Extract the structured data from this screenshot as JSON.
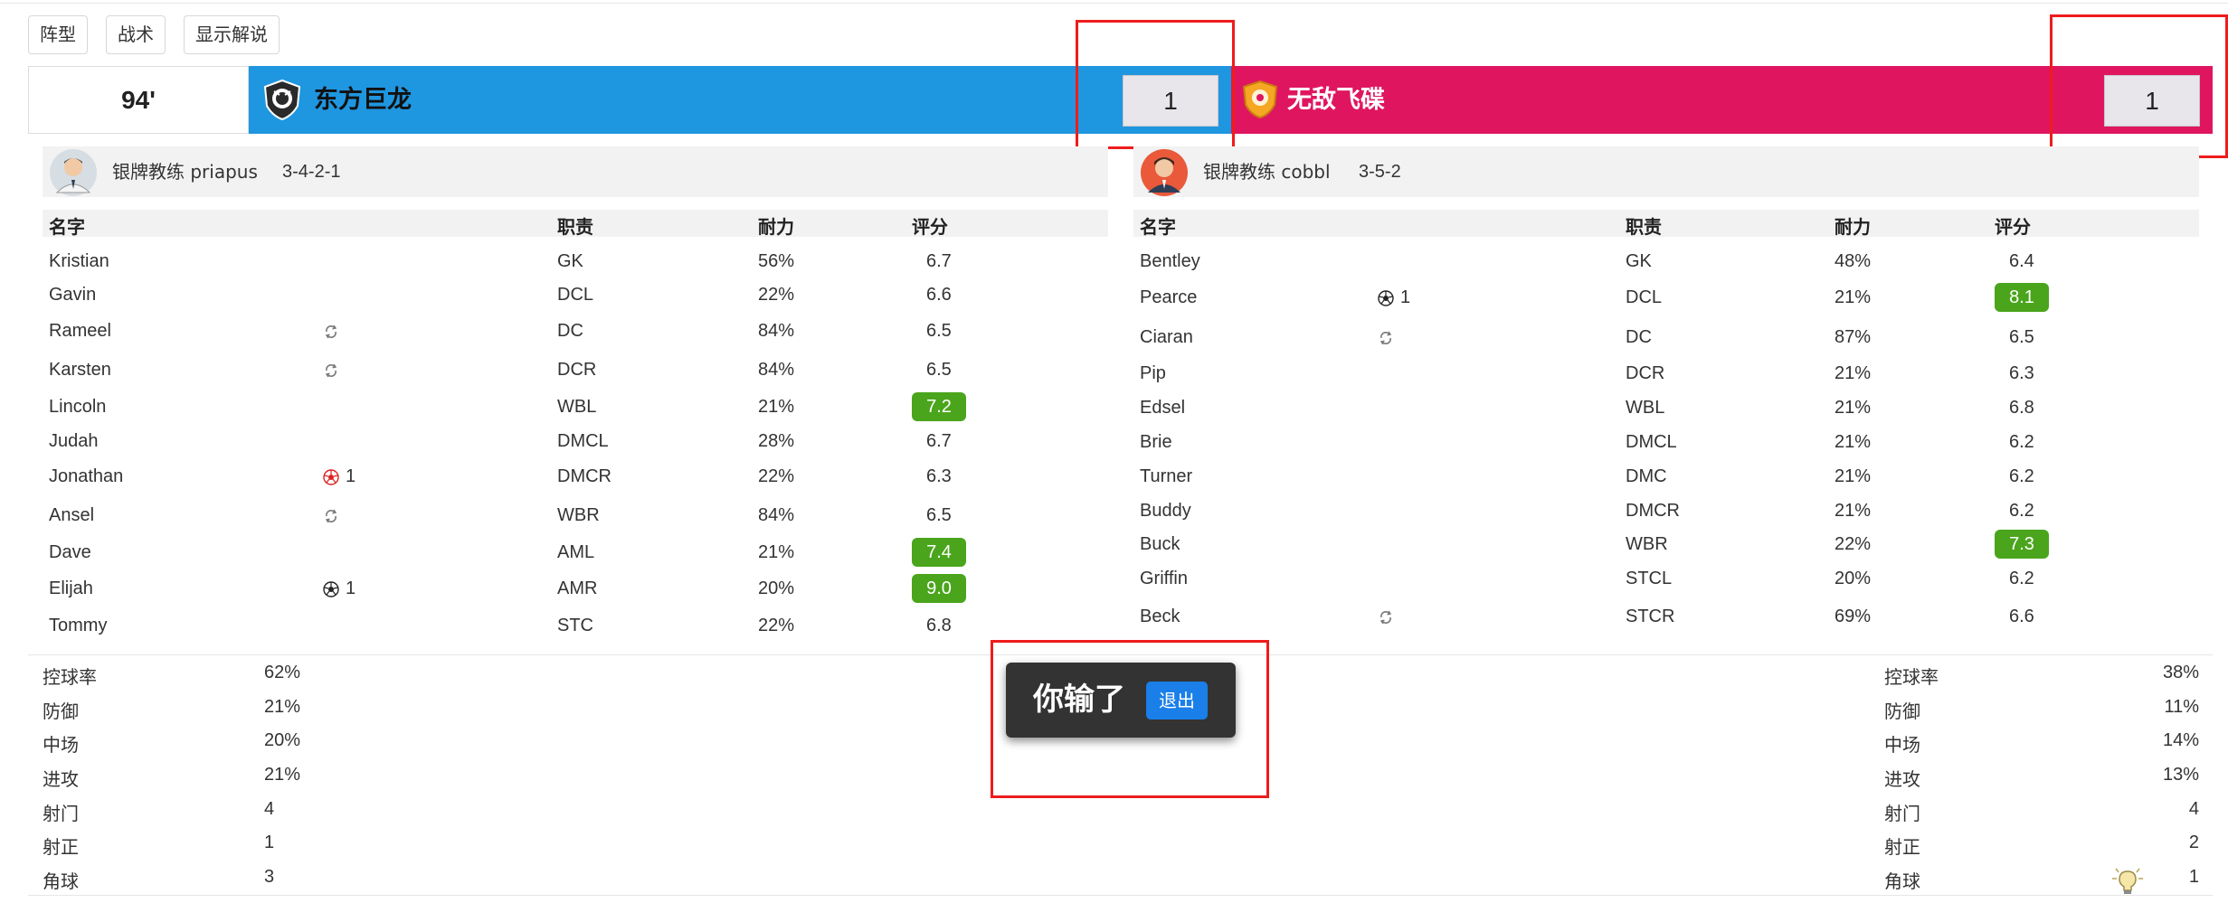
{
  "tabs": [
    "阵型",
    "战术",
    "显示解说"
  ],
  "match": {
    "minute": "94'",
    "home": {
      "name": "东方巨龙",
      "score": "1",
      "color": "#1f96e0"
    },
    "away": {
      "name": "无敌飞碟",
      "score": "1",
      "color": "#e0155f"
    }
  },
  "columns": {
    "name": "名字",
    "role": "职责",
    "stamina": "耐力",
    "rating": "评分"
  },
  "home_team": {
    "coach": "银牌教练 priapus",
    "formation": "3-4-2-1",
    "players": [
      {
        "name": "Kristian",
        "event": "",
        "event_count": "",
        "role": "GK",
        "stamina": "56%",
        "rating": "6.7",
        "highlight": false
      },
      {
        "name": "Gavin",
        "event": "",
        "event_count": "",
        "role": "DCL",
        "stamina": "22%",
        "rating": "6.6",
        "highlight": false
      },
      {
        "name": "Rameel",
        "event": "sub",
        "event_count": "",
        "role": "DC",
        "stamina": "84%",
        "rating": "6.5",
        "highlight": false
      },
      {
        "name": "Karsten",
        "event": "sub",
        "event_count": "",
        "role": "DCR",
        "stamina": "84%",
        "rating": "6.5",
        "highlight": false
      },
      {
        "name": "Lincoln",
        "event": "",
        "event_count": "",
        "role": "WBL",
        "stamina": "21%",
        "rating": "7.2",
        "highlight": true
      },
      {
        "name": "Judah",
        "event": "",
        "event_count": "",
        "role": "DMCL",
        "stamina": "28%",
        "rating": "6.7",
        "highlight": false
      },
      {
        "name": "Jonathan",
        "event": "red-ball",
        "event_count": "1",
        "role": "DMCR",
        "stamina": "22%",
        "rating": "6.3",
        "highlight": false
      },
      {
        "name": "Ansel",
        "event": "sub",
        "event_count": "",
        "role": "WBR",
        "stamina": "84%",
        "rating": "6.5",
        "highlight": false
      },
      {
        "name": "Dave",
        "event": "",
        "event_count": "",
        "role": "AML",
        "stamina": "21%",
        "rating": "7.4",
        "highlight": true
      },
      {
        "name": "Elijah",
        "event": "goal",
        "event_count": "1",
        "role": "AMR",
        "stamina": "20%",
        "rating": "9.0",
        "highlight": true
      },
      {
        "name": "Tommy",
        "event": "",
        "event_count": "",
        "role": "STC",
        "stamina": "22%",
        "rating": "6.8",
        "highlight": false
      }
    ]
  },
  "away_team": {
    "coach": "银牌教练 cobbl",
    "formation": "3-5-2",
    "players": [
      {
        "name": "Bentley",
        "event": "",
        "event_count": "",
        "role": "GK",
        "stamina": "48%",
        "rating": "6.4",
        "highlight": false
      },
      {
        "name": "Pearce",
        "event": "goal",
        "event_count": "1",
        "role": "DCL",
        "stamina": "21%",
        "rating": "8.1",
        "highlight": true
      },
      {
        "name": "Ciaran",
        "event": "sub",
        "event_count": "",
        "role": "DC",
        "stamina": "87%",
        "rating": "6.5",
        "highlight": false
      },
      {
        "name": "Pip",
        "event": "",
        "event_count": "",
        "role": "DCR",
        "stamina": "21%",
        "rating": "6.3",
        "highlight": false
      },
      {
        "name": "Edsel",
        "event": "",
        "event_count": "",
        "role": "WBL",
        "stamina": "21%",
        "rating": "6.8",
        "highlight": false
      },
      {
        "name": "Brie",
        "event": "",
        "event_count": "",
        "role": "DMCL",
        "stamina": "21%",
        "rating": "6.2",
        "highlight": false
      },
      {
        "name": "Turner",
        "event": "",
        "event_count": "",
        "role": "DMC",
        "stamina": "21%",
        "rating": "6.2",
        "highlight": false
      },
      {
        "name": "Buddy",
        "event": "",
        "event_count": "",
        "role": "DMCR",
        "stamina": "21%",
        "rating": "6.2",
        "highlight": false
      },
      {
        "name": "Buck",
        "event": "",
        "event_count": "",
        "role": "WBR",
        "stamina": "22%",
        "rating": "7.3",
        "highlight": true
      },
      {
        "name": "Griffin",
        "event": "",
        "event_count": "",
        "role": "STCL",
        "stamina": "20%",
        "rating": "6.2",
        "highlight": false
      },
      {
        "name": "Beck",
        "event": "sub",
        "event_count": "",
        "role": "STCR",
        "stamina": "69%",
        "rating": "6.6",
        "highlight": false
      }
    ]
  },
  "stats": {
    "labels": [
      "控球率",
      "防御",
      "中场",
      "进攻",
      "射门",
      "射正",
      "角球"
    ],
    "home": [
      "62%",
      "21%",
      "20%",
      "21%",
      "4",
      "1",
      "3"
    ],
    "away": [
      "38%",
      "11%",
      "14%",
      "13%",
      "4",
      "2",
      "1"
    ]
  },
  "popup": {
    "message": "你输了",
    "exit_label": "退出"
  },
  "colors": {
    "badge": "#4aa51c",
    "highlight_box": "#ee1c1c",
    "popup_bg": "#333333",
    "exit_button": "#1a7fe8"
  }
}
